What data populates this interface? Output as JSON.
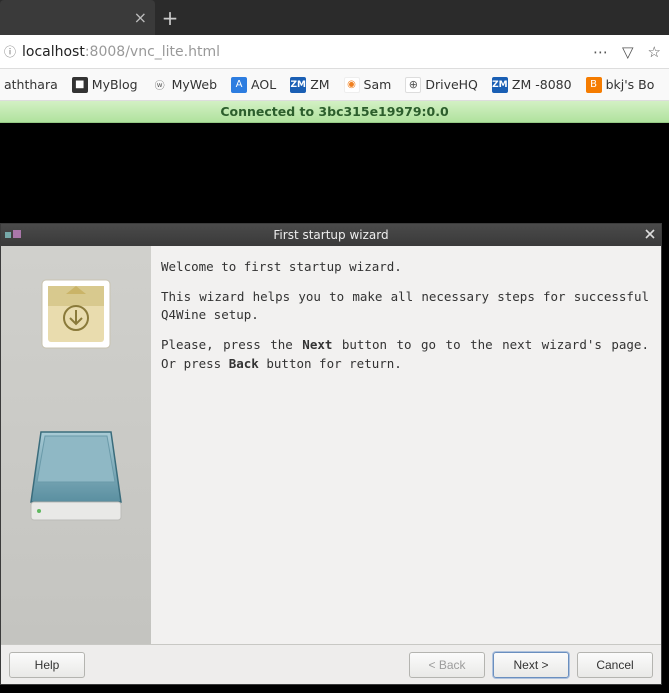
{
  "browser": {
    "url_host": "localhost",
    "url_rest": ":8008/vnc_lite.html"
  },
  "bookmarks": [
    {
      "label": "aththara"
    },
    {
      "label": "MyBlog"
    },
    {
      "label": "MyWeb"
    },
    {
      "label": "AOL"
    },
    {
      "label": "ZM"
    },
    {
      "label": "Sam"
    },
    {
      "label": "DriveHQ"
    },
    {
      "label": "ZM -8080"
    },
    {
      "label": "bkj's Bo"
    }
  ],
  "vnc": {
    "connected_text": "Connected to 3bc315e19979:0.0"
  },
  "wizard": {
    "title": "First startup wizard",
    "p1": "Welcome to first startup wizard.",
    "p2": "This wizard helps you to make all necessary steps for successful Q4Wine setup.",
    "p3a": "Please, press the ",
    "p3b": "Next",
    "p3c": " button to go to the next wizard's page. Or press ",
    "p3d": "Back",
    "p3e": " button for return.",
    "buttons": {
      "help": "Help",
      "back": "< Back",
      "next": "Next >",
      "cancel": "Cancel"
    }
  }
}
